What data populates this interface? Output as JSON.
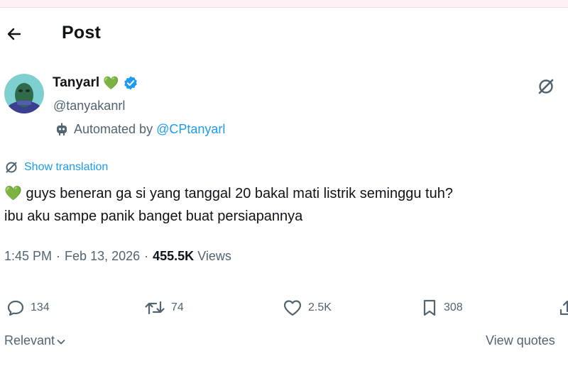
{
  "header": {
    "back_icon": "arrow-left-icon",
    "title": "Post"
  },
  "author": {
    "display_name": "Tanyarl",
    "name_emoji": "💚",
    "verified_badge_color": "#1d9bf0",
    "handle": "@tanyakanrl",
    "automated_prefix": "Automated by",
    "automated_account": "@CPtanyarl"
  },
  "post": {
    "translate_label": "Show translation",
    "text_emoji": "💚",
    "text_line1": "guys beneran ga si yang tanggal 20 bakal mati listrik seminggu tuh?",
    "text_line2": "ibu aku sampe panik banget buat persiapannya",
    "time": "1:45 PM",
    "date": "Feb 13, 2026",
    "separator": "·",
    "views_count": "455.5K",
    "views_label": "Views"
  },
  "actions": {
    "replies": "134",
    "reposts": "74",
    "likes": "2.5K",
    "bookmarks": "308"
  },
  "footer": {
    "sort_label": "Relevant",
    "view_quotes": "View quotes"
  },
  "colors": {
    "accent": "#1d9bf0",
    "muted": "#536471",
    "text": "#0f1419"
  }
}
